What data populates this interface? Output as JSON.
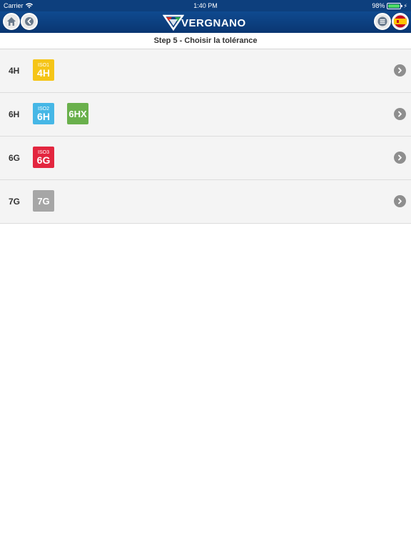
{
  "status": {
    "carrier": "Carrier",
    "time": "1:40 PM",
    "battery": "98%",
    "battery_level": 0.98
  },
  "nav": {
    "brand": "VERGNANO"
  },
  "step": {
    "title": "Step 5 - Choisir la tolérance"
  },
  "rows": [
    {
      "label": "4H",
      "badges": [
        {
          "top": "ISO1",
          "main": "4H",
          "color": "#f5c518"
        }
      ]
    },
    {
      "label": "6H",
      "badges": [
        {
          "top": "ISO2",
          "main": "6H",
          "color": "#46b7e6"
        },
        {
          "top": "",
          "main": "6HX",
          "color": "#6ab04c"
        }
      ]
    },
    {
      "label": "6G",
      "badges": [
        {
          "top": "ISO3",
          "main": "6G",
          "color": "#e3263f"
        }
      ]
    },
    {
      "label": "7G",
      "badges": [
        {
          "top": "",
          "main": "7G",
          "color": "#a6a6a6"
        }
      ]
    }
  ],
  "colors": {
    "navbar": "#0d3f7d",
    "row_bg": "#f4f4f4",
    "chevron": "#8e8e8e"
  },
  "icons": {
    "home": "home-icon",
    "back": "back-icon",
    "menu": "menu-icon",
    "language": "flag-icon",
    "row": "chevron-right-icon"
  }
}
